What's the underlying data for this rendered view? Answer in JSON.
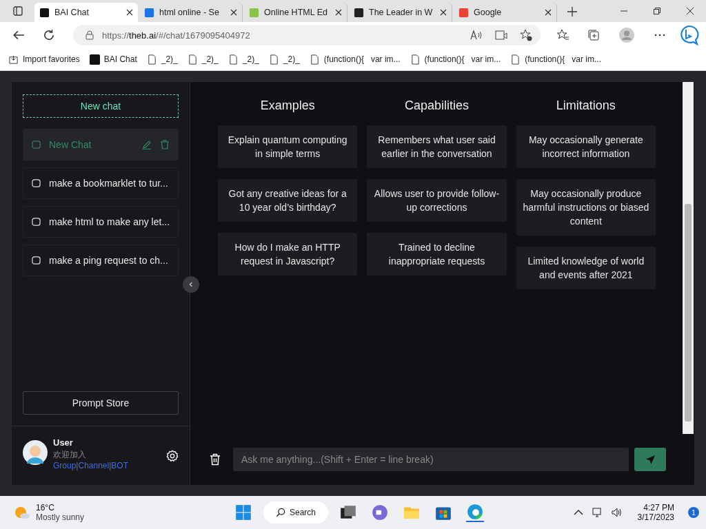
{
  "browser": {
    "tabs": [
      {
        "title": "BAI Chat",
        "selected": true
      },
      {
        "title": "html online - Se",
        "selected": false
      },
      {
        "title": "Online HTML Ed",
        "selected": false
      },
      {
        "title": "The Leader in W",
        "selected": false
      },
      {
        "title": "Google",
        "selected": false
      }
    ],
    "address": {
      "prefix": "https://",
      "host": "theb.ai",
      "path": "/#/chat/1679095404972"
    },
    "favorites": [
      "Import favorites",
      "BAI Chat",
      "_2)_",
      "_2)_",
      "_2)_",
      "_2)_",
      "(function(){   var im...",
      "(function(){   var im...",
      "(function(){   var im..."
    ]
  },
  "sidebar": {
    "new_chat_button": "New chat",
    "chats": [
      {
        "title": "New Chat",
        "selected": true
      },
      {
        "title": "make a bookmarklet to tur...",
        "selected": false
      },
      {
        "title": "make html to make any let...",
        "selected": false
      },
      {
        "title": "make a ping request to ch...",
        "selected": false
      }
    ],
    "prompt_store_button": "Prompt Store",
    "user": {
      "name": "User",
      "welcome": "欢迎加入",
      "links": [
        "Group",
        "Channel",
        "BOT"
      ],
      "separator": "|"
    }
  },
  "main": {
    "columns": [
      {
        "title": "Examples",
        "items": [
          "Explain quantum computing in simple terms",
          "Got any creative ideas for a 10 year old’s birthday?",
          "How do I make an HTTP request in Javascript?"
        ]
      },
      {
        "title": "Capabilities",
        "items": [
          "Remembers what user said earlier in the conversation",
          "Allows user to provide follow-up corrections",
          "Trained to decline inappropriate requests"
        ]
      },
      {
        "title": "Limitations",
        "items": [
          "May occasionally generate incorrect information",
          "May occasionally produce harmful instructions or biased content",
          "Limited knowledge of world and events after 2021"
        ]
      }
    ],
    "input": {
      "placeholder": "Ask me anything...(Shift + Enter = line break)"
    }
  },
  "taskbar": {
    "temperature": "16°C",
    "weather": "Mostly sunny",
    "search": "Search",
    "time": "4:27 PM",
    "date": "3/17/2023",
    "notifications": "1"
  }
}
